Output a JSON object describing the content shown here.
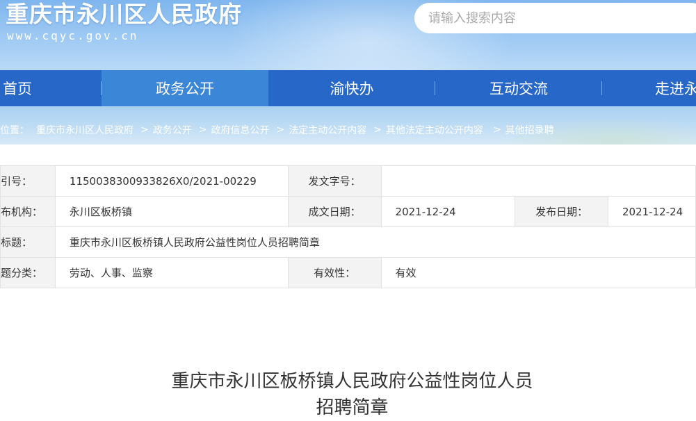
{
  "header": {
    "site_title": "重庆市永川区人民政府",
    "site_url": "www.cqyc.gov.cn",
    "search_placeholder": "请输入搜索内容"
  },
  "nav": {
    "items": [
      {
        "label": "首页"
      },
      {
        "label": "政务公开",
        "active": true
      },
      {
        "label": "渝快办"
      },
      {
        "label": "互动交流"
      },
      {
        "label": "走进永"
      }
    ]
  },
  "breadcrumb": {
    "prefix": "位置：",
    "items": [
      "重庆市永川区人民政府",
      "政务公开",
      "政府信息公开",
      "法定主动公开内容",
      "其他法定主动公开内容",
      "其他招录聘"
    ],
    "separator": ">"
  },
  "meta": {
    "index_label": "引号：",
    "index_value": "1150038300933826X0/2021-00229",
    "doc_no_label": "发文字号：",
    "doc_no_value": "",
    "org_label": "布机构：",
    "org_value": "永川区板桥镇",
    "created_label": "成文日期：",
    "created_value": "2021-12-24",
    "published_label": "发布日期：",
    "published_value": "2021-12-24",
    "subject_label": "标题：",
    "subject_value": "重庆市永川区板桥镇人民政府公益性岗位人员招聘简章",
    "category_label": "题分类：",
    "category_value": "劳动、人事、监察",
    "validity_label": "有效性：",
    "validity_value": "有效"
  },
  "article": {
    "title_line1": "重庆市永川区板桥镇人民政府公益性岗位人员",
    "title_line2": "招聘简章"
  },
  "colors": {
    "nav_bg": "#2767c7",
    "nav_active": "#3b86d6",
    "label_bg": "#f3f3f3"
  }
}
